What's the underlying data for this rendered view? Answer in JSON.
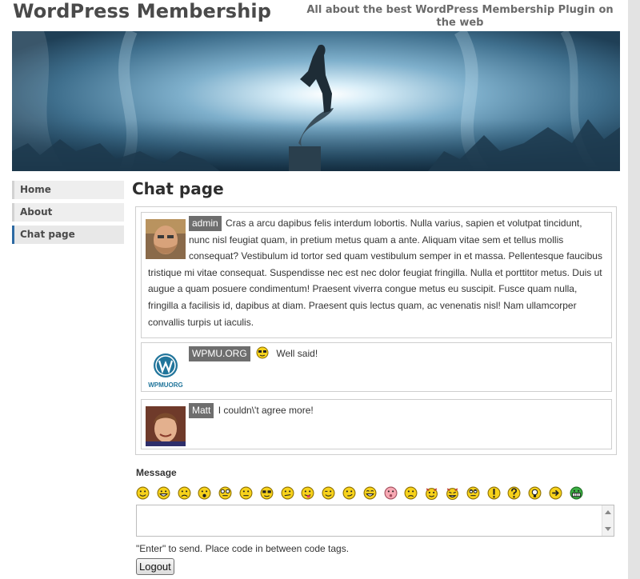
{
  "header": {
    "site_title": "WordPress Membership",
    "tagline": "All about the best WordPress Membership Plugin on the web"
  },
  "nav": {
    "items": [
      {
        "label": "Home",
        "active": false
      },
      {
        "label": "About",
        "active": false
      },
      {
        "label": "Chat page",
        "active": true
      }
    ]
  },
  "page": {
    "title": "Chat page"
  },
  "chat": {
    "messages": [
      {
        "author": "admin",
        "avatar": "bearded-man-photo",
        "text": "Cras a arcu dapibus felis interdum lobortis. Nulla varius, sapien et volutpat tincidunt, nunc nisl feugiat quam, in pretium metus quam a ante. Aliquam vitae sem et tellus mollis consequat? Vestibulum id tortor sed quam vestibulum semper in et massa. Pellentesque faucibus tristique mi vitae consequat. Suspendisse nec est nec dolor feugiat fringilla. Nulla et porttitor metus. Duis ut augue a quam posuere condimentum! Praesent viverra congue metus eu suscipit. Fusce quam nulla, fringilla a facilisis id, dapibus at diam. Praesent quis lectus quam, ac venenatis nisl! Nam ullamcorper convallis turpis ut iaculis."
      },
      {
        "author": "WPMU.ORG",
        "avatar": "wpmu-logo",
        "avatar_caption": "WPMUORG",
        "has_emoticon": true,
        "text": "Well said!"
      },
      {
        "author": "Matt",
        "avatar": "smiling-man-photo",
        "text": "I couldn\\'t agree more!"
      }
    ]
  },
  "composer": {
    "label": "Message",
    "emoticons": [
      "smile",
      "grin",
      "sad",
      "surprised",
      "cool-glasses",
      "neutral",
      "sunglasses",
      "confused",
      "tongue",
      "wink",
      "smirk",
      "laugh",
      "blush",
      "frown",
      "evil",
      "twisted",
      "rolleyes",
      "exclaim",
      "question",
      "idea",
      "arrow",
      "green-grin"
    ],
    "input_value": "",
    "hint": "\"Enter\" to send. Place code in between code tags.",
    "logout_label": "Logout"
  },
  "colors": {
    "nav_active_border": "#2d6aa3",
    "author_badge": "#6e6e6e",
    "emoticon_yellow": "#f7d21b"
  }
}
